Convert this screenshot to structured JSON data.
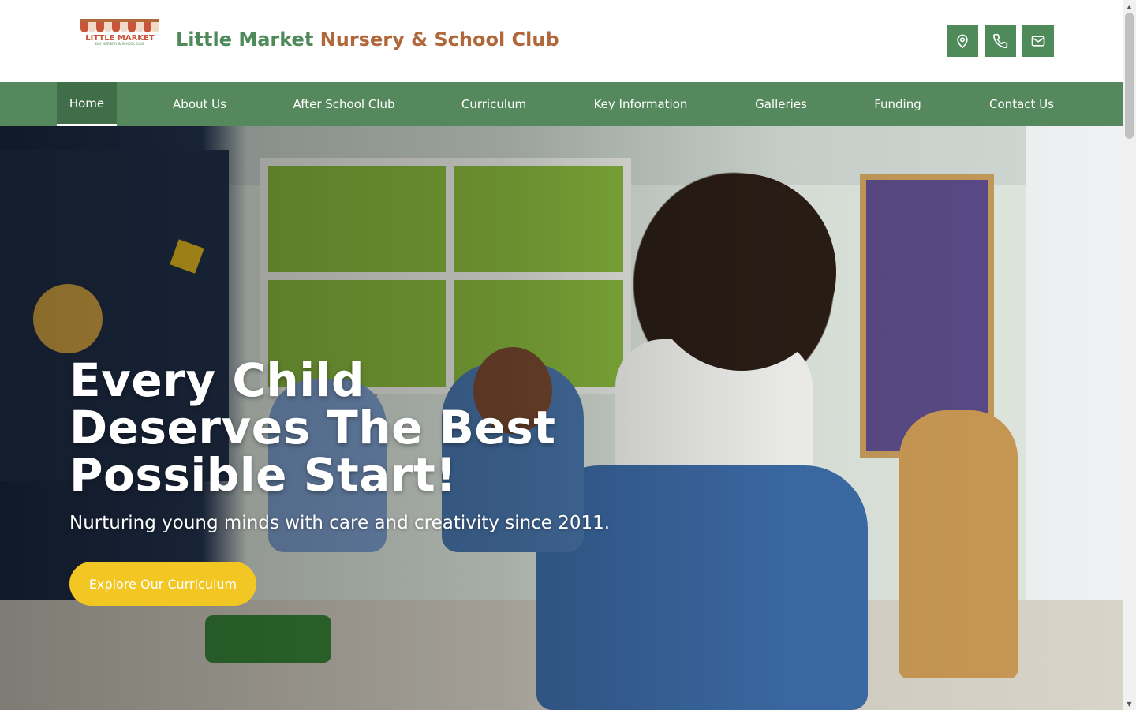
{
  "header": {
    "brand_part1": "Little Market ",
    "brand_part2": "Nursery & School Club",
    "logo_text": "LITTLE MARKET",
    "logo_subtext": "DAY NURSERY & SCHOOL CLUB",
    "icons": [
      "location-icon",
      "phone-icon",
      "mail-icon"
    ]
  },
  "nav": {
    "items": [
      {
        "label": "Home",
        "active": true
      },
      {
        "label": "About Us"
      },
      {
        "label": "After School Club"
      },
      {
        "label": "Curriculum"
      },
      {
        "label": "Key Information"
      },
      {
        "label": "Galleries"
      },
      {
        "label": "Funding"
      },
      {
        "label": "Contact Us"
      }
    ]
  },
  "hero": {
    "title": "Every Child Deserves The Best Possible Start!",
    "subtitle": "Nurturing young minds with care and creativity since 2011.",
    "cta_label": "Explore Our Curriculum"
  },
  "colors": {
    "brand_green": "#4f8a5b",
    "nav_green": "#55895d",
    "nav_active": "#3f6e48",
    "brand_brown": "#b0673a",
    "cta_yellow": "#f2c623"
  }
}
